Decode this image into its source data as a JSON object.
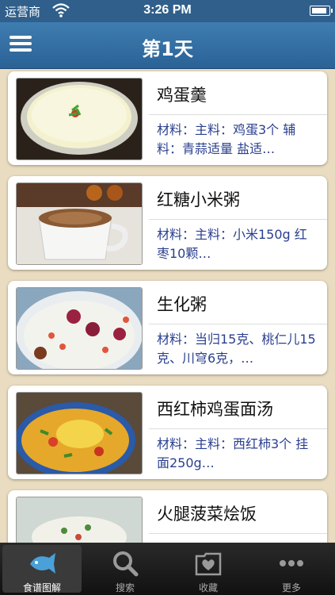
{
  "status_bar": {
    "carrier": "运营商",
    "time": "3:26 PM"
  },
  "nav": {
    "title": "第1天"
  },
  "recipes": [
    {
      "name": "鸡蛋羹",
      "desc": "材料：主料：鸡蛋3个 辅料：青蒜适量 盐适…",
      "image": "steamed-egg-custard"
    },
    {
      "name": "红糖小米粥",
      "desc": "材料：主料：小米150g 红枣10颗…",
      "image": "millet-porridge-cup"
    },
    {
      "name": "生化粥",
      "desc": "材料：当归15克、桃仁儿15克、川穹6克，…",
      "image": "red-date-congee"
    },
    {
      "name": "西红柿鸡蛋面汤",
      "desc": "材料：主料：西红柿3个 挂面250g…",
      "image": "tomato-egg-noodle-soup"
    },
    {
      "name": "火腿菠菜烩饭",
      "desc": "",
      "image": "ham-spinach-rice"
    }
  ],
  "tabs": [
    {
      "label": "食谱图解",
      "icon": "recipe-fish-icon",
      "active": true
    },
    {
      "label": "搜索",
      "icon": "search-icon",
      "active": false
    },
    {
      "label": "收藏",
      "icon": "favorites-heart-icon",
      "active": false
    },
    {
      "label": "更多",
      "icon": "more-dots-icon",
      "active": false
    }
  ],
  "colors": {
    "nav_blue": "#2f6a9e",
    "desc_text": "#2a3f8f",
    "background": "#e9dcc0"
  }
}
